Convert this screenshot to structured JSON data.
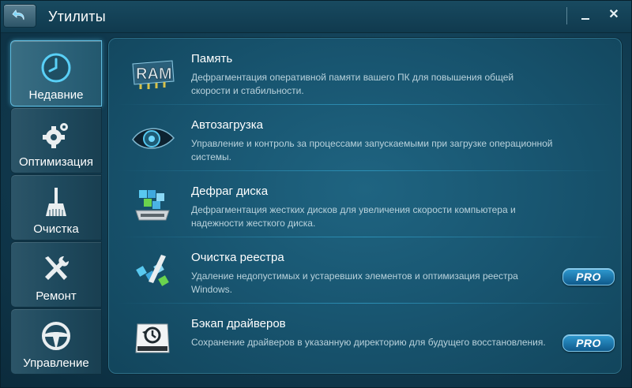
{
  "window": {
    "title": "Утилиты"
  },
  "sidebar": {
    "items": [
      {
        "label": "Недавние",
        "icon": "clock-icon",
        "active": true
      },
      {
        "label": "Оптимизация",
        "icon": "gears-icon",
        "active": false
      },
      {
        "label": "Очистка",
        "icon": "broom-icon",
        "active": false
      },
      {
        "label": "Ремонт",
        "icon": "wrench-screwdriver-icon",
        "active": false
      },
      {
        "label": "Управление",
        "icon": "steering-wheel-icon",
        "active": false
      }
    ]
  },
  "utilities": [
    {
      "name": "Память",
      "icon": "ram-icon",
      "description": "Дефрагментация оперативной памяти вашего ПК для повышения общей скорости и стабильности.",
      "badge": ""
    },
    {
      "name": "Автозагрузка",
      "icon": "startup-eye-icon",
      "description": "Управление и контроль за процессами запускаемыми при загрузке операционной системы.",
      "badge": ""
    },
    {
      "name": "Дефраг диска",
      "icon": "disk-defrag-icon",
      "description": "Дефрагментация жестких дисков для увеличения скорости компьютера и надежности жесткого диска.",
      "badge": ""
    },
    {
      "name": "Очистка реестра",
      "icon": "registry-clean-icon",
      "description": "Удаление недопустимых и устаревших элементов и оптимизация реестра Windows.",
      "badge": "PRO"
    },
    {
      "name": "Бэкап драйверов",
      "icon": "driver-backup-icon",
      "description": "Сохранение драйверов в указанную директорию для будущего восстановления.",
      "badge": "PRO"
    }
  ],
  "colors": {
    "accent": "#4fc3f0",
    "panel": "#185570",
    "background": "#123f55"
  }
}
